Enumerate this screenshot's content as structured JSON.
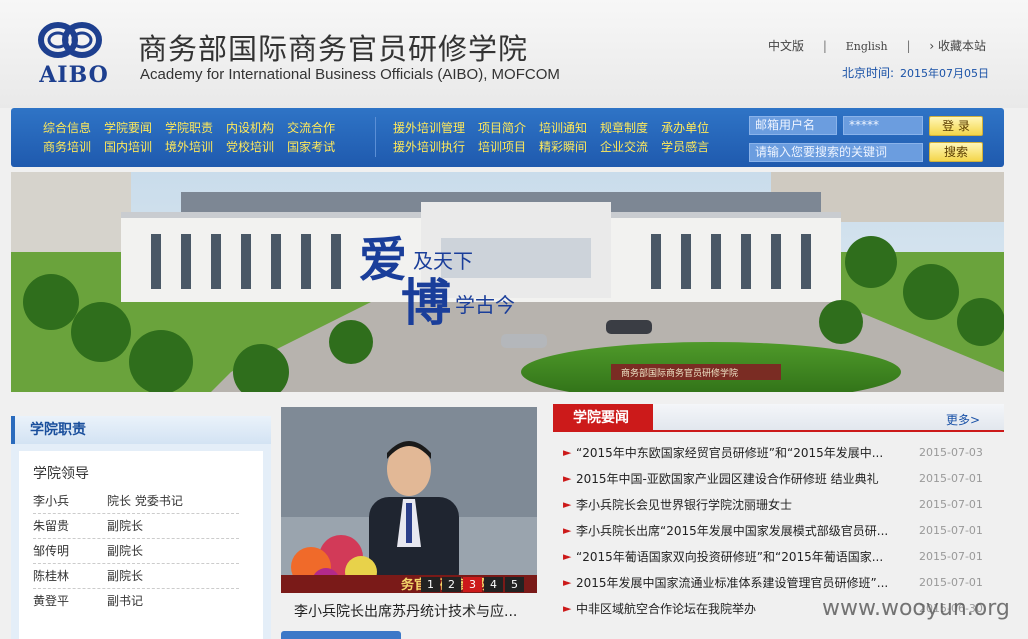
{
  "header": {
    "logo_text": "AIBO",
    "title_cn": "商务部国际商务官员研修学院",
    "title_en": "Academy for International Business Officials (AIBO), MOFCOM",
    "links": {
      "chinese": "中文版",
      "english": "English",
      "favorite": "收藏本站",
      "sep": "|"
    },
    "beijing_time_label": "北京时间:",
    "date": "2015年07月05日"
  },
  "nav": {
    "group1_row1": [
      "综合信息",
      "学院要闻",
      "学院职责",
      "内设机构",
      "交流合作"
    ],
    "group1_row2": [
      "商务培训",
      "国内培训",
      "境外培训",
      "党校培训",
      "国家考试"
    ],
    "group2_row1": [
      "援外培训管理",
      "项目简介",
      "培训通知",
      "规章制度",
      "承办单位"
    ],
    "group2_row2": [
      "援外培训执行",
      "培训项目",
      "精彩瞬间",
      "企业交流",
      "学员感言"
    ]
  },
  "login": {
    "email_placeholder": "邮箱用户名",
    "password_mask": "*****",
    "login_button": "登 录",
    "search_placeholder": "请输入您要搜索的关键词",
    "search_button": "搜索"
  },
  "banner": {
    "calligraphy_line1": "爱",
    "calligraphy_line1b": "及天下",
    "calligraphy_line2": "博",
    "calligraphy_line2b": "学古今",
    "building_sign": "商务部国际商务官员研修学院"
  },
  "duties": {
    "title": "学院职责",
    "subtitle": "学院领导",
    "leaders": [
      {
        "name": "李小兵",
        "role": "院长 党委书记"
      },
      {
        "name": "朱留贵",
        "role": "副院长"
      },
      {
        "name": "邹传明",
        "role": "副院长"
      },
      {
        "name": "陈桂林",
        "role": "副院长"
      },
      {
        "name": "黄登平",
        "role": "副书记"
      }
    ]
  },
  "photo": {
    "sign": "务官员研修学院",
    "pages": [
      "1",
      "2",
      "3",
      "4",
      "5"
    ],
    "active_page": "3",
    "caption": "李小兵院长出席苏丹统计技术与应..."
  },
  "news": {
    "title": "学院要闻",
    "more": "更多>",
    "items": [
      {
        "title": "“2015年中东欧国家经贸官员研修班”和“2015年发展中...",
        "date": "2015-07-03"
      },
      {
        "title": "2015年中国-亚欧国家产业园区建设合作研修班 结业典礼",
        "date": "2015-07-01"
      },
      {
        "title": "李小兵院长会见世界银行学院沈丽珊女士",
        "date": "2015-07-01"
      },
      {
        "title": "李小兵院长出席“2015年发展中国家发展模式部级官员研...",
        "date": "2015-07-01"
      },
      {
        "title": "“2015年葡语国家双向投资研修班”和“2015年葡语国家...",
        "date": "2015-07-01"
      },
      {
        "title": "2015年发展中国家流通业标准体系建设管理官员研修班”...",
        "date": "2015-07-01"
      },
      {
        "title": "中非区域航空合作论坛在我院举办",
        "date": "2015-06-30"
      }
    ]
  },
  "watermark": "www.wooyun.org",
  "colors": {
    "nav_blue": "#2566b8",
    "nav_text": "#ffe95a",
    "accent_red": "#cc1a1a",
    "brand_blue": "#1d3f8f"
  }
}
